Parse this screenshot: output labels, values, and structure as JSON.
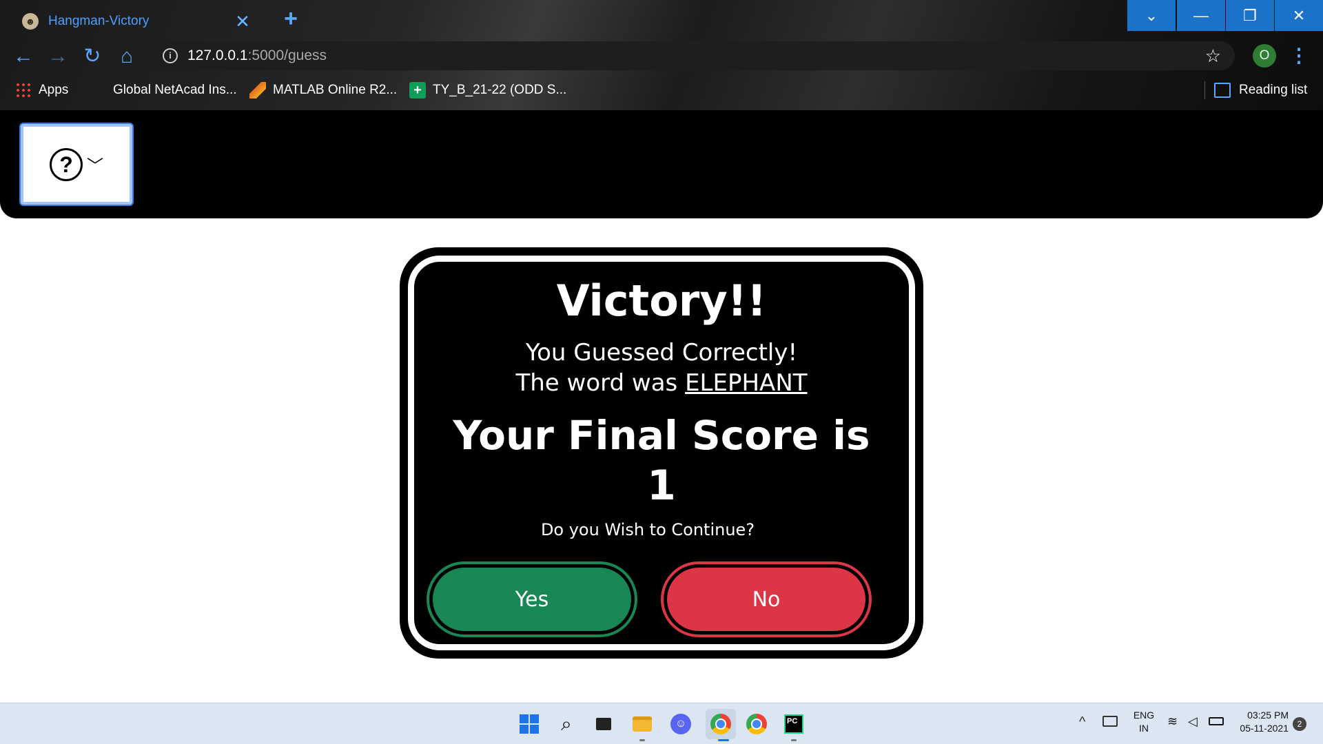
{
  "browser": {
    "tab": {
      "title": "Hangman-Victory",
      "favicon": "hangman-favicon",
      "close": "✕"
    },
    "new_tab": "+",
    "window_controls": {
      "dropdown": "⌄",
      "minimize": "—",
      "restore": "❐",
      "close": "✕"
    },
    "nav": {
      "back": "←",
      "forward": "→",
      "reload": "↻",
      "home": "⌂"
    },
    "address": {
      "host": "127.0.0.1",
      "path": ":5000/guess"
    },
    "profile_initial": "O",
    "menu": "⋮",
    "star": "☆",
    "bookmarks": [
      {
        "label": "Apps",
        "icon": "apps-grid-icon"
      },
      {
        "label": "Global NetAcad Ins...",
        "icon": "netacad-icon"
      },
      {
        "label": "MATLAB Online R2...",
        "icon": "matlab-icon"
      },
      {
        "label": "TY_B_21-22 (ODD S...",
        "icon": "sheets-icon"
      }
    ],
    "reading_list": "Reading list"
  },
  "page": {
    "help_icon": "?",
    "help_chevron": "﹀",
    "dialog": {
      "title": "Victory!!",
      "subtitle": "You Guessed Correctly!",
      "word_prefix": "The word was ",
      "word": "ELEPHANT",
      "score_label": "Your Final Score is",
      "score": "1",
      "question": "Do you Wish to Continue?",
      "yes": "Yes",
      "no": "No"
    },
    "colors": {
      "yes": "#198754",
      "no": "#dc3545",
      "accent": "#1a73c8"
    }
  },
  "taskbar": {
    "apps": [
      "start-icon",
      "search-icon",
      "task-view-icon",
      "file-explorer-icon",
      "discord-icon",
      "chrome-icon",
      "chrome-profile-icon",
      "pycharm-icon"
    ],
    "pycharm_text": "PC",
    "lang_line1": "ENG",
    "lang_line2": "IN",
    "time": "03:25 PM",
    "date": "05-11-2021",
    "notifications": "2"
  }
}
